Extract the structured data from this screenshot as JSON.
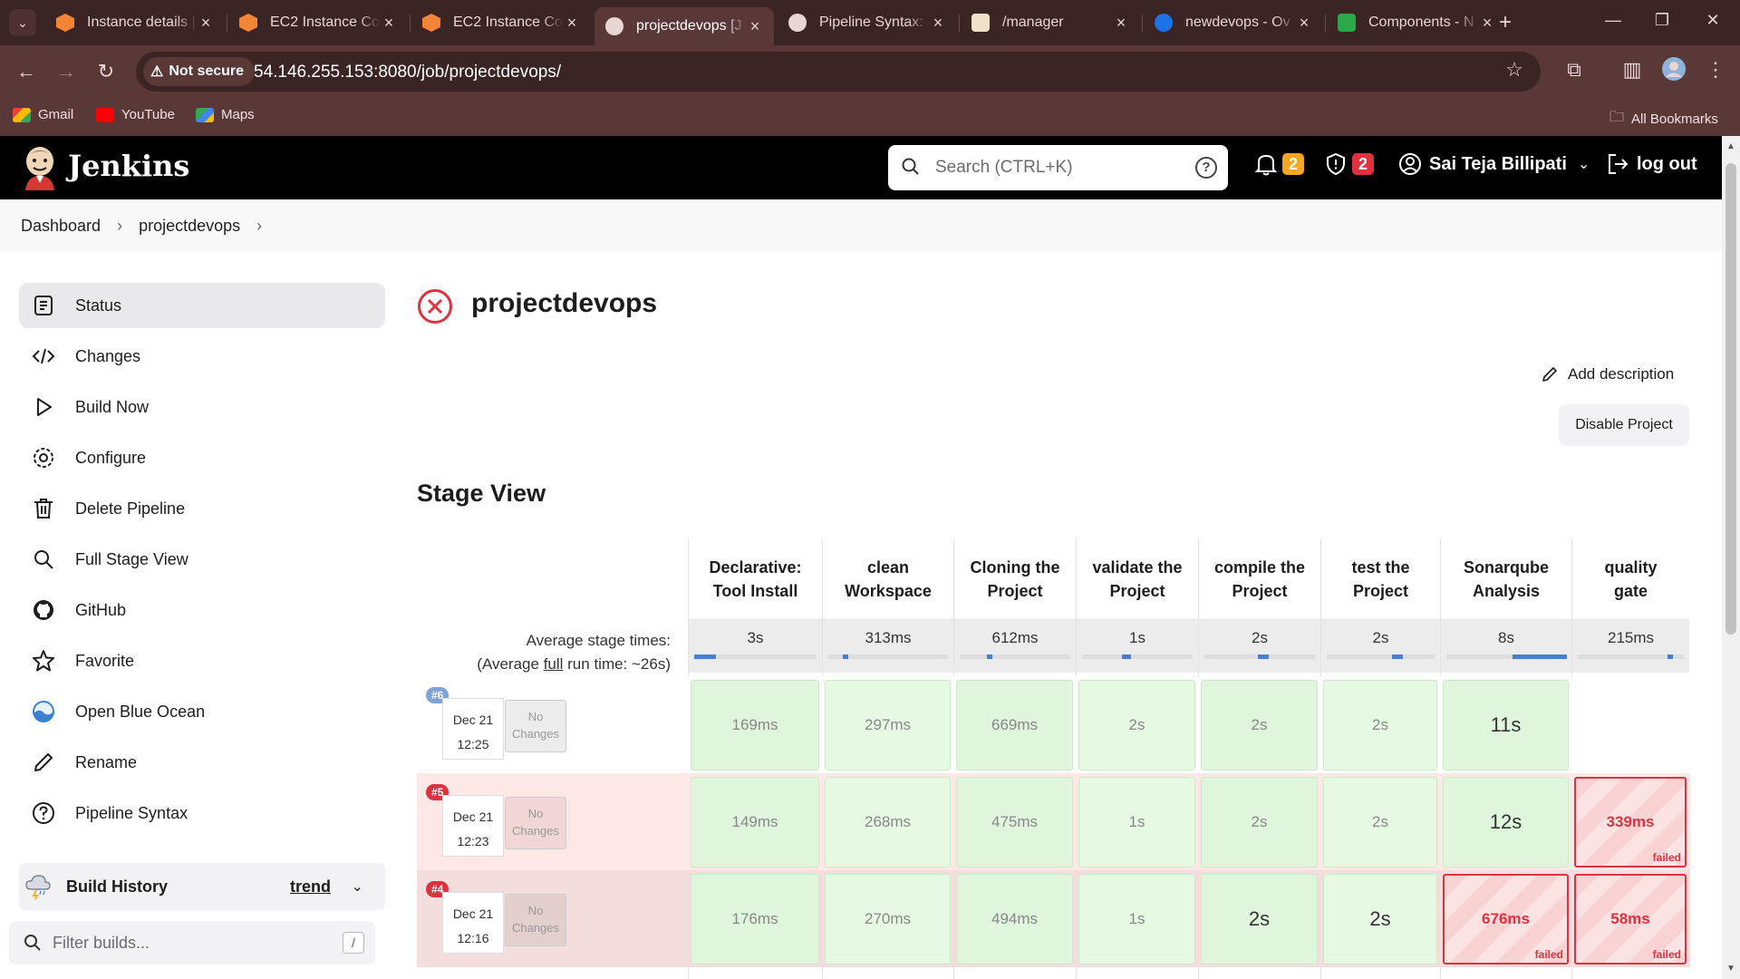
{
  "browser": {
    "tabs": [
      {
        "title": "Instance details |",
        "active": false,
        "icon": "aws-icon"
      },
      {
        "title": "EC2 Instance Cor",
        "active": false,
        "icon": "aws-icon"
      },
      {
        "title": "EC2 Instance Cor",
        "active": false,
        "icon": "aws-icon"
      },
      {
        "title": "projectdevops [J",
        "active": true,
        "icon": "jenkins-icon"
      },
      {
        "title": "Pipeline Syntax: S",
        "active": false,
        "icon": "jenkins-icon"
      },
      {
        "title": "/manager",
        "active": false,
        "icon": "tomcat-icon"
      },
      {
        "title": "newdevops - Ov",
        "active": false,
        "icon": "azure-devops-icon"
      },
      {
        "title": "Components - N",
        "active": false,
        "icon": "nexus-icon"
      }
    ],
    "not_secure_label": "Not secure",
    "url": "54.146.255.153:8080/job/projectdevops/",
    "bookmarks": [
      {
        "label": "Gmail",
        "icon": "gmail-icon"
      },
      {
        "label": "YouTube",
        "icon": "youtube-icon"
      },
      {
        "label": "Maps",
        "icon": "maps-icon"
      }
    ],
    "all_bookmarks_label": "All Bookmarks",
    "colors": {
      "frame": "#3b2524",
      "toolbar": "#5a3837"
    }
  },
  "jenkins": {
    "brand": "Jenkins",
    "search_placeholder": "Search (CTRL+K)",
    "notifications_count": "2",
    "security_count": "2",
    "user_name": "Sai Teja Billipati",
    "logout_label": "log out",
    "colors": {
      "notif_badge": "#f5a623",
      "security_badge": "#e0323e",
      "failure": "#d9343f"
    }
  },
  "breadcrumb": [
    "Dashboard",
    "projectdevops"
  ],
  "sidebar": {
    "items": [
      {
        "label": "Status",
        "icon": "status-icon",
        "active": true
      },
      {
        "label": "Changes",
        "icon": "code-icon",
        "active": false
      },
      {
        "label": "Build Now",
        "icon": "play-icon",
        "active": false
      },
      {
        "label": "Configure",
        "icon": "gear-icon",
        "active": false
      },
      {
        "label": "Delete Pipeline",
        "icon": "trash-icon",
        "active": false
      },
      {
        "label": "Full Stage View",
        "icon": "search-icon",
        "active": false
      },
      {
        "label": "GitHub",
        "icon": "github-icon",
        "active": false
      },
      {
        "label": "Favorite",
        "icon": "star-icon",
        "active": false
      },
      {
        "label": "Open Blue Ocean",
        "icon": "blue-ocean-icon",
        "active": false
      },
      {
        "label": "Rename",
        "icon": "pencil-icon",
        "active": false
      },
      {
        "label": "Pipeline Syntax",
        "icon": "help-icon",
        "active": false
      }
    ],
    "build_history_label": "Build History",
    "trend_label": "trend",
    "filter_placeholder": "Filter builds...",
    "filter_shortcut": "/"
  },
  "main": {
    "project_title": "projectdevops",
    "project_status": "failed",
    "add_description_label": "Add description",
    "disable_project_label": "Disable Project",
    "stage_view_title": "Stage View",
    "avg_stage_times_label": "Average stage times:",
    "avg_full_prefix": "(Average ",
    "avg_full_link": "full",
    "avg_full_suffix": " run time: ~26s)",
    "stages": [
      {
        "name_lines": [
          "Declarative:",
          "Tool Install"
        ],
        "avg": "3s",
        "bar": 0.18
      },
      {
        "name_lines": [
          "clean",
          "Workspace"
        ],
        "avg": "313ms",
        "bar": 0.04
      },
      {
        "name_lines": [
          "Cloning the",
          "Project"
        ],
        "avg": "612ms",
        "bar": 0.04
      },
      {
        "name_lines": [
          "validate the",
          "Project"
        ],
        "avg": "1s",
        "bar": 0.08
      },
      {
        "name_lines": [
          "compile the",
          "Project"
        ],
        "avg": "2s",
        "bar": 0.1
      },
      {
        "name_lines": [
          "test the",
          "Project"
        ],
        "avg": "2s",
        "bar": 0.1
      },
      {
        "name_lines": [
          "Sonarqube",
          "Analysis"
        ],
        "avg": "8s",
        "bar": 0.45
      },
      {
        "name_lines": [
          "quality",
          "gate"
        ],
        "avg": "215ms",
        "bar": 0.04
      }
    ],
    "builds": [
      {
        "number": "#6",
        "date": "Dec 21",
        "time": "12:25",
        "changes": [
          "No",
          "Changes"
        ],
        "status": "running",
        "cells": [
          "169ms",
          "297ms",
          "669ms",
          "2s",
          "2s",
          "2s",
          "11s",
          null
        ],
        "cell_status": [
          "ok",
          "ok",
          "ok",
          "ok",
          "ok",
          "ok",
          "ok",
          "empty"
        ]
      },
      {
        "number": "#5",
        "date": "Dec 21",
        "time": "12:23",
        "changes": [
          "No",
          "Changes"
        ],
        "status": "failed",
        "cells": [
          "149ms",
          "268ms",
          "475ms",
          "1s",
          "2s",
          "2s",
          "12s",
          "339ms"
        ],
        "cell_status": [
          "ok",
          "ok",
          "ok",
          "ok",
          "ok",
          "ok",
          "ok",
          "failed"
        ]
      },
      {
        "number": "#4",
        "date": "Dec 21",
        "time": "12:16",
        "changes": [
          "No",
          "Changes"
        ],
        "status": "failed",
        "cells": [
          "176ms",
          "270ms",
          "494ms",
          "1s",
          "2s",
          "2s",
          "676ms",
          "58ms"
        ],
        "cell_status": [
          "ok",
          "ok",
          "ok",
          "ok",
          "ok",
          "ok",
          "failed",
          "failed"
        ]
      }
    ],
    "failed_tag": "failed"
  }
}
